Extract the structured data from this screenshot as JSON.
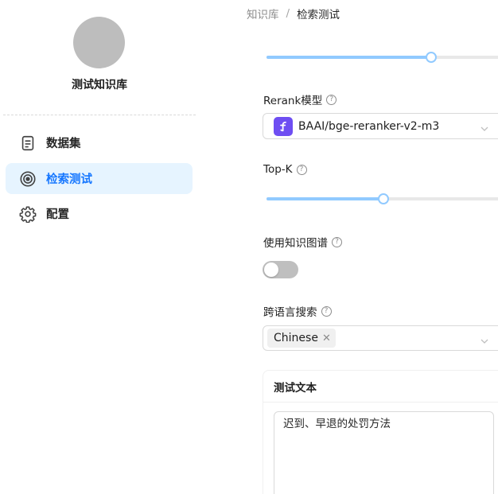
{
  "sidebar": {
    "kb_name": "测试知识库",
    "items": [
      {
        "label": "数据集",
        "icon": "document-icon",
        "active": false
      },
      {
        "label": "检索测试",
        "icon": "target-icon",
        "active": true
      },
      {
        "label": "配置",
        "icon": "gear-icon",
        "active": false
      }
    ]
  },
  "breadcrumb": {
    "parent": "知识库",
    "separator": "/",
    "current": "检索测试"
  },
  "settings": {
    "similarity_slider_fraction": 0.69,
    "rerank_label": "Rerank模型",
    "rerank_value": "BAAI/bge-reranker-v2-m3",
    "rerank_logo_icon": "siliconflow-logo-icon",
    "topk_label": "Top-K",
    "topk_slider_fraction": 0.49,
    "kg_label": "使用知识图谱",
    "kg_enabled": false,
    "cross_lang_label": "跨语言搜索",
    "cross_lang_tags": [
      "Chinese"
    ],
    "help_glyph": "?"
  },
  "test_card": {
    "title": "测试文本",
    "text": "迟到、早退的处罚方法"
  },
  "colors": {
    "accent": "#1677ff",
    "active_bg": "#e6f4ff",
    "slider": "#91caff",
    "logo_bg": "#6e4ef2"
  }
}
